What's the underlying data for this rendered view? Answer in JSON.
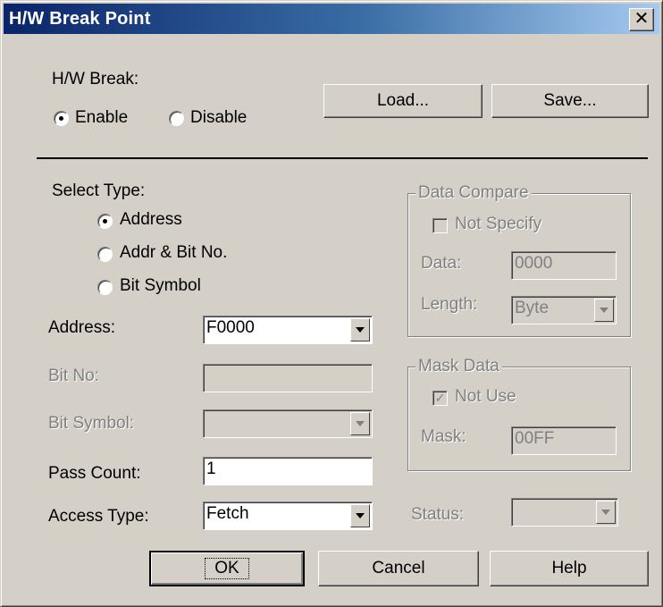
{
  "window": {
    "title": "H/W Break Point",
    "close_glyph": "✕"
  },
  "hw_break": {
    "label": "H/W Break:",
    "enable_label": "Enable",
    "disable_label": "Disable",
    "selected": "Enable"
  },
  "buttons": {
    "load": "Load...",
    "save": "Save...",
    "ok": "OK",
    "cancel": "Cancel",
    "help": "Help"
  },
  "select_type": {
    "label": "Select Type:",
    "options": [
      "Address",
      "Addr & Bit No.",
      "Bit Symbol"
    ],
    "selected": "Address"
  },
  "fields": {
    "address": {
      "label": "Address:",
      "value": "F0000"
    },
    "bit_no": {
      "label": "Bit No:",
      "value": ""
    },
    "bit_symbol": {
      "label": "Bit Symbol:",
      "value": ""
    },
    "pass_count": {
      "label": "Pass Count:",
      "value": "1"
    },
    "access_type": {
      "label": "Access Type:",
      "value": "Fetch"
    }
  },
  "data_compare": {
    "title": "Data Compare",
    "not_specify_label": "Not Specify",
    "data_label": "Data:",
    "data_value": "0000",
    "length_label": "Length:",
    "length_value": "Byte"
  },
  "mask_data": {
    "title": "Mask Data",
    "not_use_label": "Not Use",
    "not_use_check": "✓",
    "mask_label": "Mask:",
    "mask_value": "00FF"
  },
  "status": {
    "label": "Status:",
    "value": ""
  },
  "colors": {
    "face": "#d4d0c8",
    "title_start": "#0a246a",
    "title_end": "#a6caf0",
    "disabled_text": "#808080"
  }
}
